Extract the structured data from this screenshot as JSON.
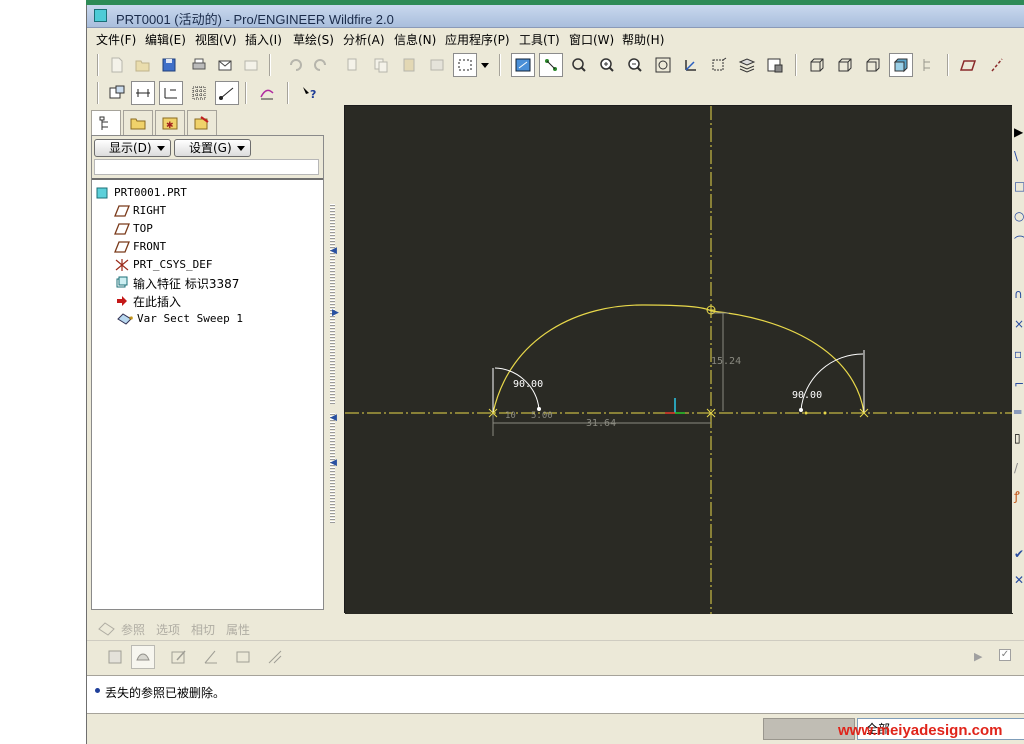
{
  "window": {
    "title": "PRT0001 (活动的) - Pro/ENGINEER Wildfire 2.0"
  },
  "menu": [
    "文件(F)",
    "编辑(E)",
    "视图(V)",
    "插入(I)",
    "草绘(S)",
    "分析(A)",
    "信息(N)",
    "应用程序(P)",
    "工具(T)",
    "窗口(W)",
    "帮助(H)"
  ],
  "toolbar_icons": {
    "row1": [
      "new-icon",
      "open-icon",
      "save-icon",
      "print-icon",
      "send-mail-icon",
      "send-mail-attach-icon",
      "undo-icon",
      "redo-icon",
      "cut-icon",
      "copy-icon",
      "paste-icon",
      "paste-special-icon",
      "regenerate-icon",
      "select-box-icon",
      "dropdown-icon",
      "sketch-orient-icon",
      "sketch-point-icon",
      "zoom-area-icon",
      "zoom-in-icon",
      "zoom-out-icon",
      "refit-icon",
      "reorient-icon",
      "saved-views-icon",
      "layers-icon",
      "view-manager-icon",
      "wireframe-icon",
      "hidden-line-icon",
      "no-hidden-icon",
      "shading-icon",
      "model-tree-toggle-icon",
      "datum-plane-icon",
      "datum-axis-icon"
    ],
    "row2": [
      "sketch-setup-icon",
      "disp-dims-icon",
      "disp-constraints-icon",
      "disp-grid-icon",
      "disp-vertices-icon",
      "sketch-analysis-icon",
      "context-help-icon"
    ]
  },
  "navigator": {
    "tabs": [
      "model-tree-tab-icon",
      "folder-browser-tab-icon",
      "favorites-tab-icon",
      "connections-tab-icon"
    ],
    "display_button": "显示(D)",
    "settings_button": "设置(G)"
  },
  "model_tree": {
    "items": [
      {
        "label": "PRT0001.PRT",
        "icon": "part-icon"
      },
      {
        "label": "RIGHT",
        "icon": "datum-plane-icon"
      },
      {
        "label": "TOP",
        "icon": "datum-plane-icon"
      },
      {
        "label": "FRONT",
        "icon": "datum-plane-icon"
      },
      {
        "label": "PRT_CSYS_DEF",
        "icon": "csys-icon"
      },
      {
        "label": "输入特征 标识3387",
        "icon": "import-feature-icon"
      },
      {
        "label": "在此插入",
        "icon": "insert-here-arrow-icon"
      },
      {
        "label": "Var Sect Sweep 1",
        "icon": "var-sect-sweep-icon"
      }
    ]
  },
  "sketch": {
    "dims": {
      "left_angle": "90.00",
      "right_angle": "90.00",
      "height": "15.24",
      "width": "31.64",
      "small_left": "10",
      "small_mid": "5.00"
    },
    "colors": {
      "background": "#2a2a24",
      "curve": "#e8d84a",
      "centerline": "#e8d84a",
      "dimension": "#8a8a80",
      "dim_text": "#ffffff"
    }
  },
  "dashboard": {
    "tabs": [
      "参照",
      "选项",
      "相切",
      "属性"
    ],
    "tool_icons": [
      "solid-icon",
      "surface-icon",
      "edit-section-icon",
      "remove-material-icon",
      "thicken-icon",
      "constant-section-icon"
    ]
  },
  "message": "丢失的参照已被删除。",
  "status": {
    "filter": "全部"
  },
  "watermark": "www.meiyadesign.com"
}
